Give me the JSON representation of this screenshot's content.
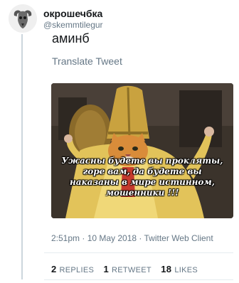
{
  "tweet": {
    "display_name": "окрошечбка",
    "handle": "@skemmtilegur",
    "text": "аминб",
    "translate_label": "Translate Tweet",
    "image_caption": "Ужасны будете вы прокляты, горе вам, да будете вы наказаны в мире истинном, мошенники !!!",
    "timestamp": "2:51pm · 10 May 2018 · Twitter Web Client",
    "stats": {
      "replies_count": "2",
      "replies_label": "REPLIES",
      "retweets_count": "1",
      "retweets_label": "RETWEET",
      "likes_count": "18",
      "likes_label": "LIKES"
    }
  },
  "colors": {
    "text_primary": "#14171a",
    "text_secondary": "#657786",
    "divider": "#e6ecf0",
    "thread_line": "#ccd6dd"
  },
  "icons": {
    "avatar": "ram-skull-avatar"
  }
}
